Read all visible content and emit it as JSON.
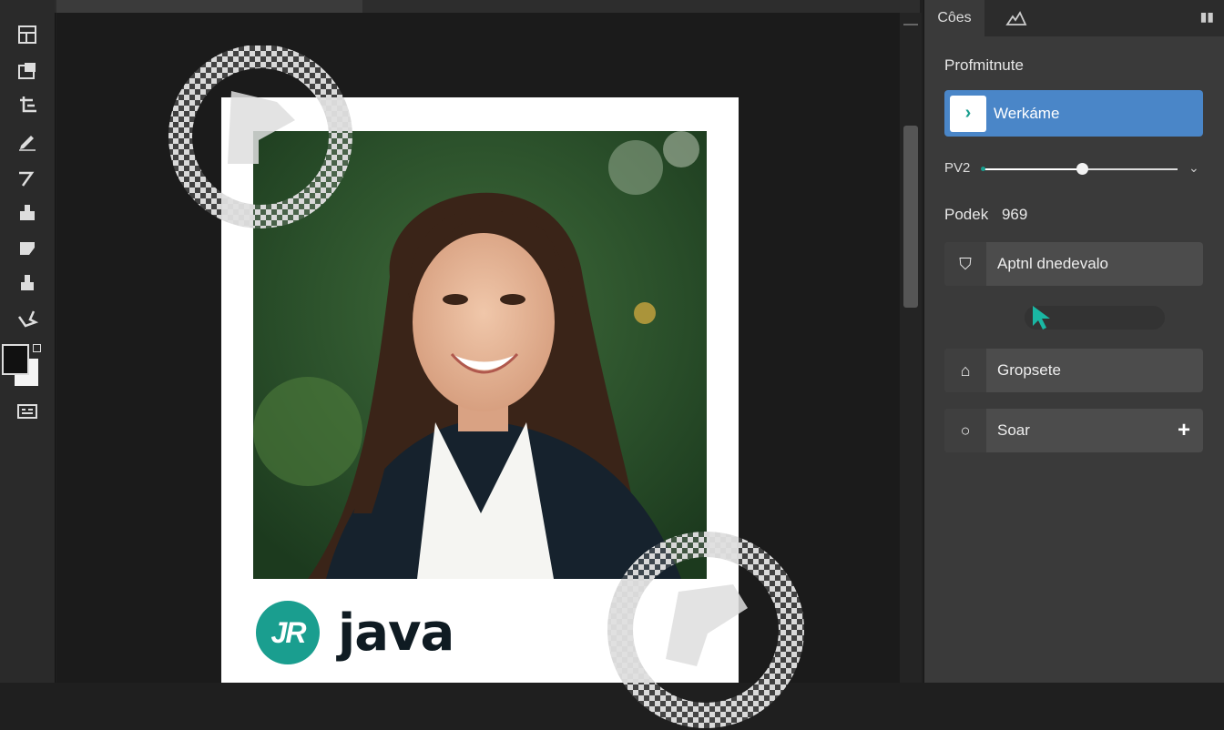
{
  "toolbar": {
    "tools": [
      {
        "icon": "artboard-icon"
      },
      {
        "icon": "frame-icon"
      },
      {
        "icon": "crop-icon"
      },
      {
        "icon": "pen-icon"
      },
      {
        "icon": "brush-icon"
      },
      {
        "icon": "stamp-icon"
      },
      {
        "icon": "eraser-icon"
      },
      {
        "icon": "fill-icon"
      },
      {
        "icon": "lasso-icon"
      }
    ],
    "foreground_color": "#111111",
    "background_color": "#f4f4f4"
  },
  "canvas": {
    "brand_badge": "JR",
    "brand_name": "java",
    "accent": "#1a9e8f"
  },
  "panel": {
    "tabs": [
      {
        "label": "Côes"
      },
      {
        "label": ""
      }
    ],
    "section_title": "Profmitnute",
    "primary_button": {
      "icon_glyph": "›",
      "label": "Werkáme"
    },
    "slider": {
      "label": "PV2",
      "value": 0.51
    },
    "pixel": {
      "label": "Podek",
      "value": "969"
    },
    "buttons": [
      {
        "name": "apply-button",
        "icon_glyph": "⛉",
        "label": "Aptnl dnedevalo"
      },
      {
        "name": "gropsete-button",
        "icon_glyph": "⌂",
        "label": "Gropsete"
      },
      {
        "name": "search-button",
        "icon_glyph": "○",
        "label": "Soar",
        "extra": "+"
      }
    ],
    "progress": 0.0
  }
}
